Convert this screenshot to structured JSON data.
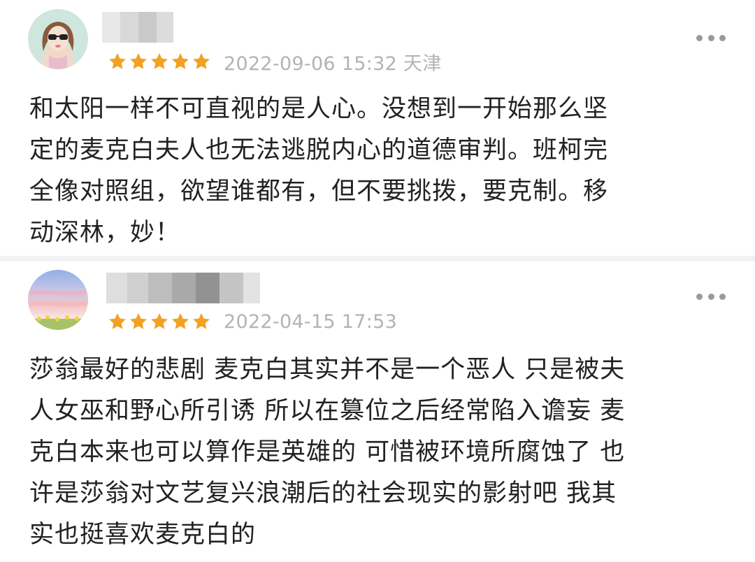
{
  "colors": {
    "star": "#f2a122",
    "meta_text": "#b3b3b3",
    "divider": "#f2f2f2"
  },
  "reviews": [
    {
      "rating": 5,
      "meta": "2022-09-06 15:32 天津",
      "content": "和太阳一样不可直视的是人心。没想到一开始那么坚\n定的麦克白夫人也无法逃脱内心的道德审判。班柯完\n全像对照组，欲望谁都有，但不要挑拨，要克制。移\n动深林，妙！",
      "avatar_icon": "girl-with-sunglasses-avatar"
    },
    {
      "rating": 5,
      "meta": "2022-04-15 17:53",
      "content": "莎翁最好的悲剧 麦克白其实并不是一个恶人 只是被夫\n人女巫和野心所引诱 所以在篡位之后经常陷入谵妄 麦\n克白本来也可以算作是英雄的 可惜被环境所腐蚀了 也\n许是莎翁对文艺复兴浪潮后的社会现实的影射吧 我其\n实也挺喜欢麦克白的",
      "avatar_icon": "sunset-sky-avatar"
    }
  ]
}
